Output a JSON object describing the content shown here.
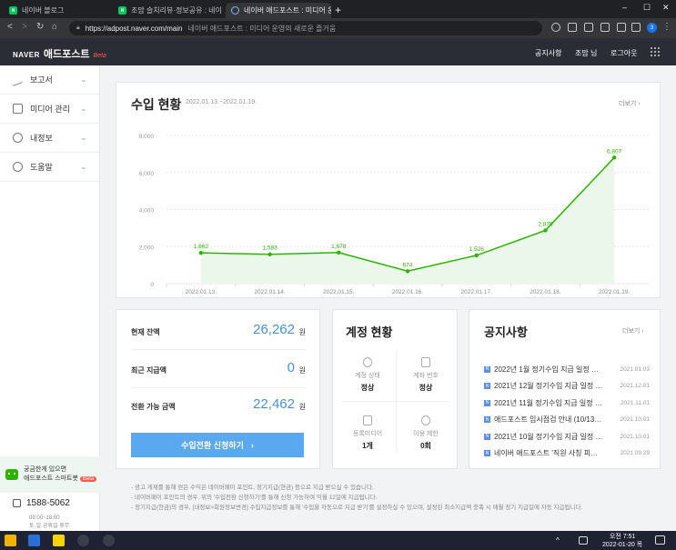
{
  "browser": {
    "tabs": [
      {
        "label": "네이버 블로그",
        "icon": "naver-blog-favicon"
      },
      {
        "label": "조맘 슬치리뷰·정보공유 : 네이",
        "icon": "naver-blog-favicon"
      },
      {
        "label": "네이버 애드포스트 : 미디어 운",
        "icon": "loading-favicon"
      }
    ],
    "fav_text": "N",
    "new_tab": "+",
    "url": "https://adpost.naver.com/main",
    "url_title": "네이버 애드포스트 : 미디어 운영의 새로운 즐거움",
    "profile_initial": "3",
    "window_controls": [
      "–",
      "☐",
      "✕"
    ]
  },
  "header": {
    "naver": "NAVER",
    "adpost": "애드포스트",
    "beta": "Beta",
    "links": [
      "공지사항",
      "조맘 님",
      "로그아웃"
    ]
  },
  "sidebar": {
    "items": [
      {
        "label": "보고서",
        "icon": "chart-line-icon"
      },
      {
        "label": "미디어 관리",
        "icon": "document-icon"
      },
      {
        "label": "내정보",
        "icon": "user-icon"
      },
      {
        "label": "도움말",
        "icon": "headset-icon"
      }
    ],
    "chevron": "⌄",
    "bot": {
      "line1": "궁금한게 있으면",
      "line2": "애드포스트 스마트봇",
      "beta": "Beta"
    },
    "phone": "1588-5062",
    "hours": [
      "09:00~18:00",
      "토·일·공휴일 휴무"
    ]
  },
  "revenue": {
    "title": "수입 현황",
    "date_range": "2022.01.13.~2022.01.19.",
    "more": "더보기"
  },
  "chart_data": {
    "type": "area",
    "title": "수입 현황",
    "categories": [
      "2022.01.13.",
      "2022.01.14.",
      "2022.01.15.",
      "2022.01.16.",
      "2022.01.17.",
      "2022.01.18.",
      "2022.01.19."
    ],
    "values": [
      1662,
      1583,
      1678,
      674,
      1526,
      2875,
      6807
    ],
    "value_labels": [
      "1,662",
      "1,583",
      "1,678",
      "674",
      "1,526",
      "2,875",
      "6,807"
    ],
    "yticks": [
      0,
      2000,
      4000,
      6000,
      8000
    ],
    "ytick_labels": [
      "0",
      "2,000",
      "4,000",
      "6,000",
      "8,000"
    ],
    "ylim": [
      0,
      8000
    ],
    "line_color": "#2db400",
    "fill_color": "#eaf7ea",
    "grid": true
  },
  "balance": {
    "rows": [
      {
        "label": "현재 잔액",
        "value": "26,262",
        "unit": "원"
      },
      {
        "label": "최근 지급액",
        "value": "0",
        "unit": "원"
      },
      {
        "label": "전환 가능 금액",
        "value": "22,462",
        "unit": "원"
      }
    ],
    "button": "수입전환 신청하기",
    "button_arrow": "›"
  },
  "account": {
    "title": "계정 현황",
    "cells": [
      {
        "label": "계정 상태",
        "value": "정상",
        "icon": "user-icon"
      },
      {
        "label": "계좌 번호",
        "value": "정상",
        "icon": "bank-icon"
      },
      {
        "label": "등록미디어",
        "value": "1개",
        "icon": "media-icon"
      },
      {
        "label": "이용 제한",
        "value": "0회",
        "icon": "restrict-icon"
      }
    ]
  },
  "notices": {
    "title": "공지사항",
    "more": "더보기",
    "badge": "N",
    "items": [
      {
        "text": "2022년 1월 정기수입 지급 일정 …",
        "date": "2021.01.03"
      },
      {
        "text": "2021년 12월 정기수입 지급 일정 …",
        "date": "2021.12.01"
      },
      {
        "text": "2021년 11월 정기수입 지급 일정 …",
        "date": "2021.11.01"
      },
      {
        "text": "애드포스트 임시점검 안내 (10/13…",
        "date": "2021.10.01"
      },
      {
        "text": "2021년 10월 정기수입 지급 일정 …",
        "date": "2021.10.01"
      },
      {
        "text": "네이버 애드포스트 '직원 사칭 피…",
        "date": "2021.09.29"
      }
    ]
  },
  "notes": [
    "- 광고 게재를 통해 얻은 수익은 네이버페이 포인트, 정기지급(현금) 등으로 지급 받으실 수 있습니다.",
    "- 네이버페이 포인트의 경우, 위의 '수입전환 신청하기'를 통해 신청 가능하며 익월 12일에 지급됩니다.",
    "- 정기지급(현금)의 경우, [내정보>회원정보변경] 수입지급정보를 통해 '수입을 자동으로 지급 받기'를 설정하실 수 있으며, 설정된 최소지급액 충족 시 매월 정기 지급일에 자동 지급됩니다."
  ],
  "taskbar": {
    "time": "오전 7:51",
    "date": "2022-01-20 목"
  }
}
